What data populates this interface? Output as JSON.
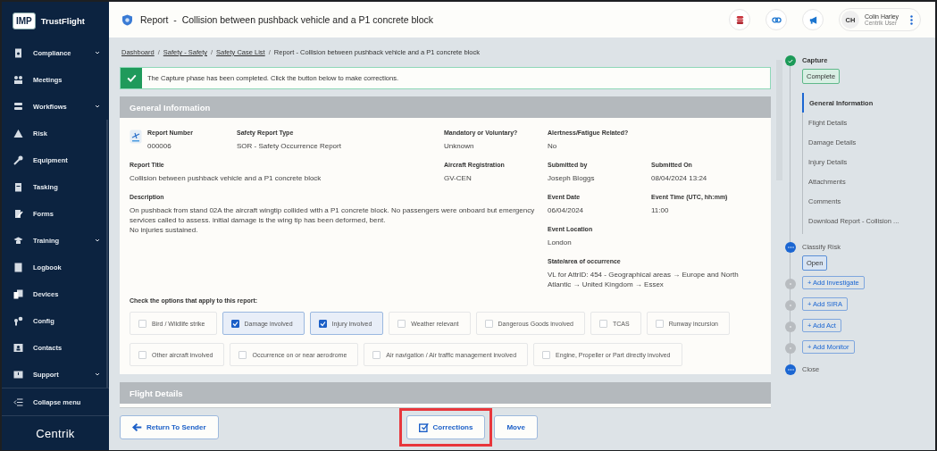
{
  "sidebar": {
    "logo_badge": "IMP",
    "logo_text": "TrustFlight",
    "items": [
      {
        "label": "Compliance",
        "expandable": true
      },
      {
        "label": "Meetings",
        "expandable": false
      },
      {
        "label": "Workflows",
        "expandable": true
      },
      {
        "label": "Risk",
        "expandable": false
      },
      {
        "label": "Equipment",
        "expandable": false
      },
      {
        "label": "Tasking",
        "expandable": false
      },
      {
        "label": "Forms",
        "expandable": false
      },
      {
        "label": "Training",
        "expandable": true
      },
      {
        "label": "Logbook",
        "expandable": false
      },
      {
        "label": "Devices",
        "expandable": false
      },
      {
        "label": "Config",
        "expandable": false
      },
      {
        "label": "Contacts",
        "expandable": false
      },
      {
        "label": "Support",
        "expandable": true
      }
    ],
    "collapse": "Collapse menu",
    "footer_logo": "Centrik"
  },
  "header": {
    "title": "Report  -  Collision between pushback vehicle and a P1 concrete block",
    "user": {
      "initials": "CH",
      "name": "Colin Harley",
      "role": "Centrik User"
    }
  },
  "breadcrumb": [
    {
      "label": "Dashboard",
      "link": true
    },
    {
      "separator": "/",
      "label": "Safety - Safety",
      "link": true
    },
    {
      "separator": "/",
      "label": "Safety Case List",
      "link": true
    },
    {
      "separator": "/",
      "label": "Report - Collision between pushback vehicle and a P1 concrete block",
      "link": false
    }
  ],
  "alert": "The Capture phase has been completed. Click the button below to make corrections.",
  "general_information": {
    "title": "General Information",
    "fields": [
      {
        "label": "Report Number",
        "value": "000006"
      },
      {
        "label": "Safety Report Type",
        "value": "SOR - Safety Occurrence Report"
      },
      {
        "label": "Mandatory or Voluntary?",
        "value": "Unknown"
      },
      {
        "label": "Alertness/Fatigue Related?",
        "value": "No"
      },
      {
        "label": "Report Title",
        "value": "Collision between pushback vehicle and a P1 concrete block"
      },
      {
        "label": "Aircraft Registration",
        "value": "GV-CEN"
      },
      {
        "label": "Submitted by",
        "value": "Joseph Bloggs"
      },
      {
        "label": "Submitted On",
        "value": "08/04/2024 13:24"
      },
      {
        "label": "Description",
        "value": "On pushback from stand 02A the aircraft wingtip collided with a P1 concrete block. No passengers were onboard but emergency services called to assess. initial damage is the wing tip has been deformed, bent.\nNo injuries sustained."
      },
      {
        "label": "Event Date",
        "value": "06/04/2024"
      },
      {
        "label": "Event Time (UTC, hh:mm)",
        "value": "11:00"
      },
      {
        "label": "Event Location",
        "value": "London"
      },
      {
        "label": "State/area of occurrence",
        "value": "VL for AttrID: 454 - Geographical areas → Europe and North Atlantic → United Kingdom → Essex"
      }
    ],
    "options_label": "Check the options that apply to this report:",
    "options": [
      {
        "label": "Bird / Wildlife strike",
        "checked": false
      },
      {
        "label": "Damage involved",
        "checked": true
      },
      {
        "label": "Injury involved",
        "checked": true
      },
      {
        "label": "Weather relevant",
        "checked": false
      },
      {
        "label": "Dangerous Goods involved",
        "checked": false
      },
      {
        "label": "TCAS",
        "checked": false
      },
      {
        "label": "Runway incursion",
        "checked": false
      },
      {
        "label": "Other aircraft involved",
        "checked": false
      },
      {
        "label": "Occurrence on or near aerodrome",
        "checked": false
      },
      {
        "label": "Air navigation / Air traffic management involved",
        "checked": false
      },
      {
        "label": "Engine, Propeller or Part directly involved",
        "checked": false
      }
    ]
  },
  "flight_details": {
    "title": "Flight Details"
  },
  "actions": [
    {
      "label": "Return To Sender",
      "kind": "back",
      "highlighted": false
    },
    {
      "label": "Corrections",
      "kind": "edit",
      "highlighted": true
    },
    {
      "label": "Move",
      "kind": "plain",
      "highlighted": false
    }
  ],
  "steps": [
    {
      "kind": "phase",
      "label": "Capture",
      "done": true,
      "active": false,
      "badge": "Complete",
      "nav": [
        {
          "label": "General Information",
          "selected": true
        },
        {
          "label": "Flight Details",
          "selected": false
        },
        {
          "label": "Damage Details",
          "selected": false
        },
        {
          "label": "Injury Details",
          "selected": false
        },
        {
          "label": "Attachments",
          "selected": false
        },
        {
          "label": "Comments",
          "selected": false
        },
        {
          "label": "Download Report - Collision ...",
          "selected": false
        }
      ]
    },
    {
      "kind": "phase",
      "label": "Classify Risk",
      "done": false,
      "active": true,
      "badge": "Open"
    },
    {
      "kind": "action",
      "label": "+ Add Investigate",
      "done": false,
      "active": false
    },
    {
      "kind": "action",
      "label": "+ Add SIRA",
      "done": false,
      "active": false
    },
    {
      "kind": "action",
      "label": "+ Add Act",
      "done": false,
      "active": false
    },
    {
      "kind": "action",
      "label": "+ Add Monitor",
      "done": false,
      "active": false
    },
    {
      "kind": "phase",
      "label": "Close",
      "done": false,
      "active": true
    }
  ]
}
